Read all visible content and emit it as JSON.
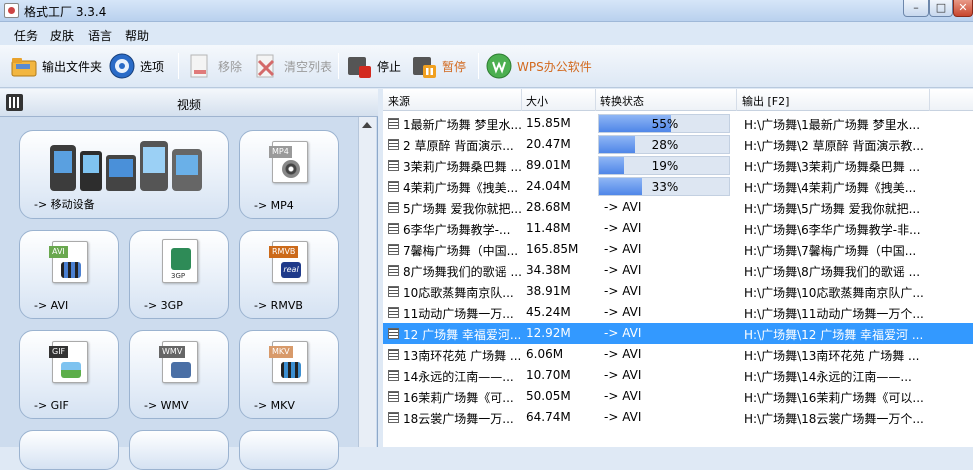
{
  "window": {
    "title": "格式工厂 3.3.4"
  },
  "menu": [
    "任务",
    "皮肤",
    "语言",
    "帮助"
  ],
  "toolbar": {
    "output_folder": "输出文件夹",
    "options": "选项",
    "remove": "移除",
    "clear_list": "清空列表",
    "stop": "停止",
    "pause": "暂停",
    "wps": "WPS办公软件"
  },
  "left_panel": {
    "category": "视频",
    "tiles": [
      {
        "label": "-> 移动设备",
        "icon": "mobile-devices-icon"
      },
      {
        "label": "-> MP4",
        "icon": "mp4-file-icon",
        "badge": "MP4",
        "badge_color": "#9a9a9a"
      },
      {
        "label": "-> AVI",
        "icon": "avi-file-icon",
        "badge": "AVI",
        "badge_color": "#6aa84f"
      },
      {
        "label": "-> 3GP",
        "icon": "3gp-file-icon",
        "badge": "3GP",
        "badge_color": "#2e8b57"
      },
      {
        "label": "-> RMVB",
        "icon": "rmvb-file-icon",
        "badge": "RMVB",
        "badge_color": "#cc6a1a"
      },
      {
        "label": "-> GIF",
        "icon": "gif-file-icon",
        "badge": "GIF",
        "badge_color": "#333333"
      },
      {
        "label": "-> WMV",
        "icon": "wmv-file-icon",
        "badge": "WMV",
        "badge_color": "#666666"
      },
      {
        "label": "-> MKV",
        "icon": "mkv-file-icon",
        "badge": "MKV",
        "badge_color": "#d89a6a"
      }
    ]
  },
  "list": {
    "columns": {
      "source": "来源",
      "size": "大小",
      "status": "转换状态",
      "output": "输出 [F2]"
    },
    "rows": [
      {
        "source": "1最新广场舞 梦里水...",
        "size": "15.85M",
        "status": "55%",
        "progress": 55,
        "output": "H:\\广场舞\\1最新广场舞 梦里水..."
      },
      {
        "source": "2 草原醉 背面演示...",
        "size": "20.47M",
        "status": "28%",
        "progress": 28,
        "output": "H:\\广场舞\\2 草原醉 背面演示教..."
      },
      {
        "source": "3茉莉广场舞桑巴舞 ...",
        "size": "89.01M",
        "status": "19%",
        "progress": 19,
        "output": "H:\\广场舞\\3茉莉广场舞桑巴舞 ..."
      },
      {
        "source": "4茉莉广场舞《拽美...",
        "size": "24.04M",
        "status": "33%",
        "progress": 33,
        "output": "H:\\广场舞\\4茉莉广场舞《拽美..."
      },
      {
        "source": "5广场舞 爱我你就把...",
        "size": "28.68M",
        "status": "-> AVI",
        "output": "H:\\广场舞\\5广场舞 爱我你就把..."
      },
      {
        "source": "6李华广场舞教学-...",
        "size": "11.48M",
        "status": "-> AVI",
        "output": "H:\\广场舞\\6李华广场舞教学-非..."
      },
      {
        "source": "7馨梅广场舞（中国...",
        "size": "165.85M",
        "status": "-> AVI",
        "output": "H:\\广场舞\\7馨梅广场舞（中国..."
      },
      {
        "source": "8广场舞我们的歌谣 ...",
        "size": "34.38M",
        "status": "-> AVI",
        "output": "H:\\广场舞\\8广场舞我们的歌谣 ..."
      },
      {
        "source": "10応歌蒸舞南京队...",
        "size": "38.91M",
        "status": "-> AVI",
        "output": "H:\\广场舞\\10応歌蒸舞南京队广..."
      },
      {
        "source": "11动动广场舞一万...",
        "size": "45.24M",
        "status": "-> AVI",
        "output": "H:\\广场舞\\11动动广场舞一万个..."
      },
      {
        "source": "12 广场舞 幸福爱河...",
        "size": "12.92M",
        "status": "-> AVI",
        "output": "H:\\广场舞\\12 广场舞 幸福爱河 ...",
        "selected": true
      },
      {
        "source": "13南环花苑 广场舞 ...",
        "size": "6.06M",
        "status": "-> AVI",
        "output": "H:\\广场舞\\13南环花苑 广场舞 ..."
      },
      {
        "source": "14永远的江南——...",
        "size": "10.70M",
        "status": "-> AVI",
        "output": "H:\\广场舞\\14永远的江南——..."
      },
      {
        "source": "16茉莉广场舞《可...",
        "size": "50.05M",
        "status": "-> AVI",
        "output": "H:\\广场舞\\16茉莉广场舞《可以..."
      },
      {
        "source": "18云裳广场舞一万...",
        "size": "64.74M",
        "status": "-> AVI",
        "output": "H:\\广场舞\\18云裳广场舞一万个..."
      }
    ]
  }
}
